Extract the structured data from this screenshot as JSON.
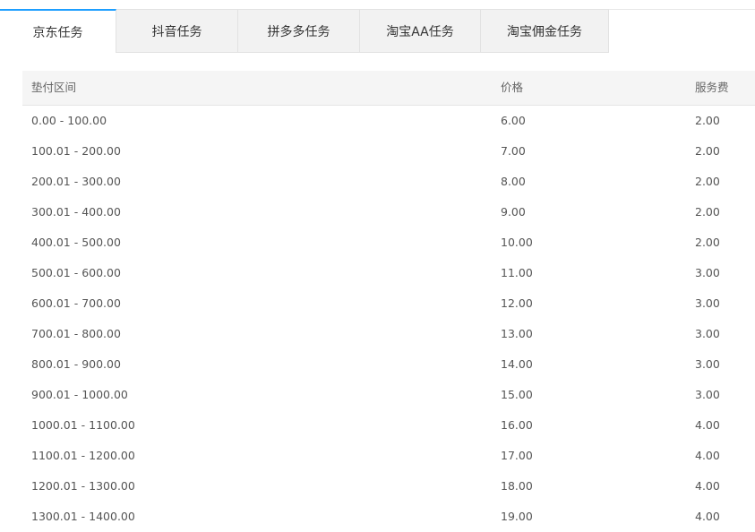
{
  "tabs": [
    {
      "label": "京东任务",
      "active": true
    },
    {
      "label": "抖音任务",
      "active": false
    },
    {
      "label": "拼多多任务",
      "active": false
    },
    {
      "label": "淘宝AA任务",
      "active": false
    },
    {
      "label": "淘宝佣金任务",
      "active": false
    }
  ],
  "table": {
    "headers": [
      "垫付区间",
      "价格",
      "服务费"
    ],
    "rows": [
      [
        "0.00 - 100.00",
        "6.00",
        "2.00"
      ],
      [
        "100.01 - 200.00",
        "7.00",
        "2.00"
      ],
      [
        "200.01 - 300.00",
        "8.00",
        "2.00"
      ],
      [
        "300.01 - 400.00",
        "9.00",
        "2.00"
      ],
      [
        "400.01 - 500.00",
        "10.00",
        "2.00"
      ],
      [
        "500.01 - 600.00",
        "11.00",
        "3.00"
      ],
      [
        "600.01 - 700.00",
        "12.00",
        "3.00"
      ],
      [
        "700.01 - 800.00",
        "13.00",
        "3.00"
      ],
      [
        "800.01 - 900.00",
        "14.00",
        "3.00"
      ],
      [
        "900.01 - 1000.00",
        "15.00",
        "3.00"
      ],
      [
        "1000.01 - 1100.00",
        "16.00",
        "4.00"
      ],
      [
        "1100.01 - 1200.00",
        "17.00",
        "4.00"
      ],
      [
        "1200.01 - 1300.00",
        "18.00",
        "4.00"
      ],
      [
        "1300.01 - 1400.00",
        "19.00",
        "4.00"
      ]
    ]
  },
  "colors": {
    "accent": "#1e9fff",
    "header_bg": "#f5f5f5",
    "tab_bg": "#f2f2f2"
  }
}
